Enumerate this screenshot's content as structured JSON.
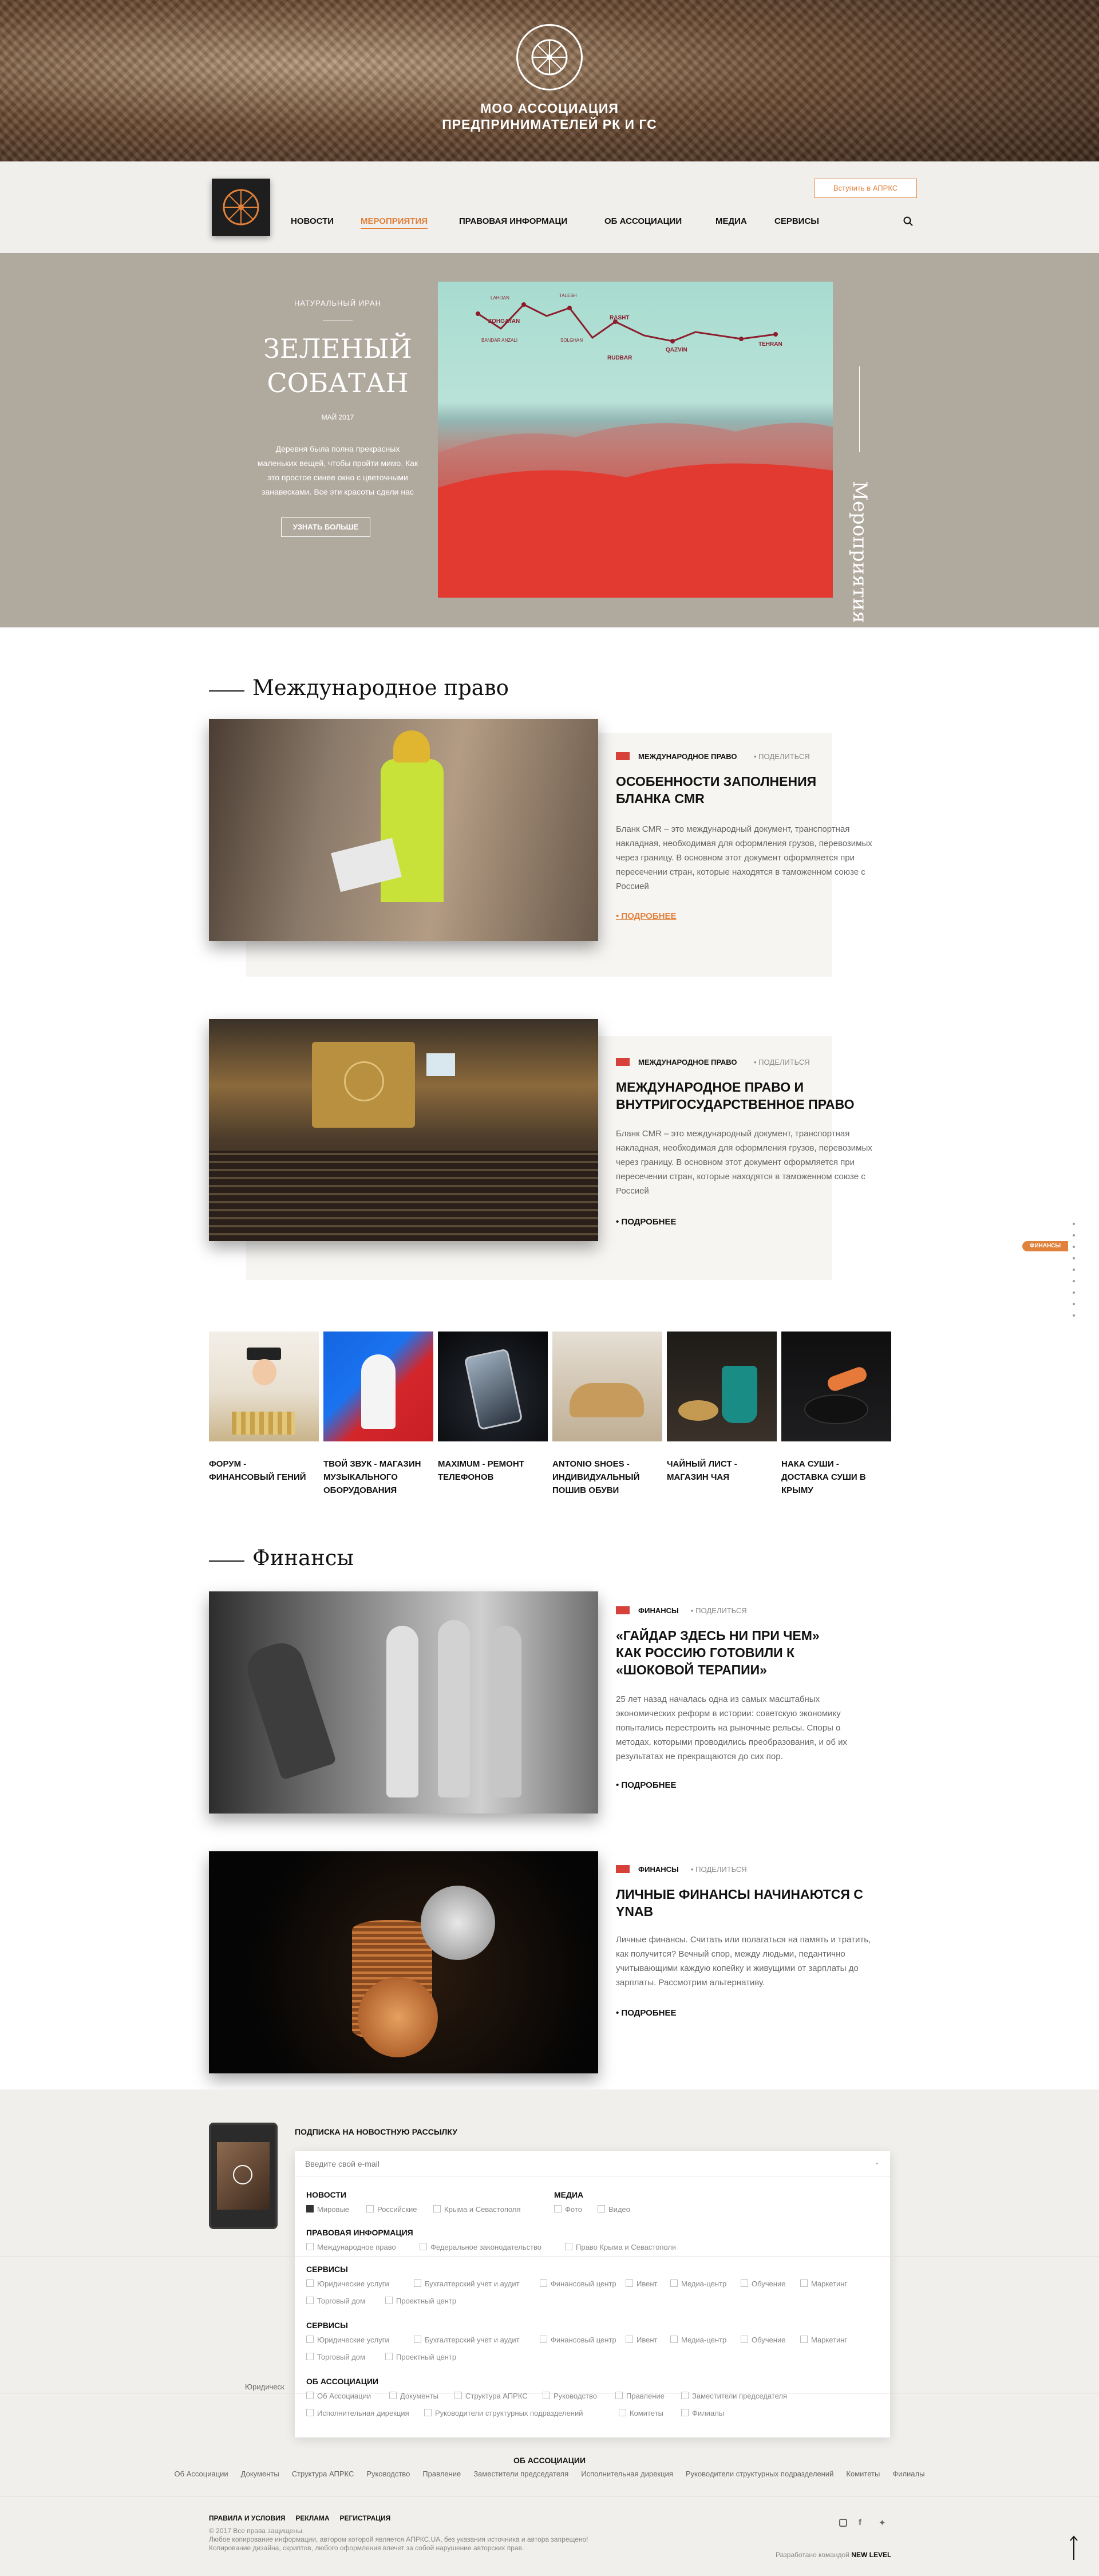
{
  "colors": {
    "accent": "#e0813c",
    "feature_bg": "#b0a99e",
    "header_bg": "#f1efec",
    "flag": "#d8403a"
  },
  "hero": {
    "title_line1": "МОО АССОЦИАЦИЯ",
    "title_line2": "ПРЕДПРИНИМАТЕЛЕЙ РК И ГС",
    "logo_icon": "wheel-emblem-icon"
  },
  "header": {
    "join_button": "Вступить в АПРКС",
    "nav": [
      "НОВОСТИ",
      "МЕРОПРИЯТИЯ",
      "ПРАВОВАЯ ИНФОРМАЦИ",
      "ОБ АССОЦИАЦИИ",
      "МЕДИА",
      "СЕРВИСЫ"
    ],
    "active_nav": "МЕРОПРИЯТИЯ",
    "search_icon": "search-icon"
  },
  "feature": {
    "category": "НАТУРАЛЬНЫЙ ИРАН",
    "title_line1": "ЗЕЛЕНЫЙ",
    "title_line2": "СОБАТАН",
    "date": "МАЙ 2017",
    "text_lines": [
      "Деревня была полна прекрасных",
      "маленьких вещей, чтобы пройти мимо. Как",
      "это простое синее окно с цветочными",
      "занавесками. Все эти красоты сдели нас"
    ],
    "button": "УЗНАТЬ БОЛЬШЕ",
    "vertical_label": "Мероприятия",
    "map_labels": [
      "ZOHGATAN",
      "LAHIJAN",
      "TALESH",
      "RASHT",
      "SOLGHAN",
      "QAZVIN",
      "TEHRAN",
      "RUDBAR",
      "BANDAR ANZALI"
    ]
  },
  "sections": {
    "law": {
      "title": "Международное право",
      "articles": [
        {
          "category": "МЕЖДУНАРОДНОЕ ПРАВО",
          "share": "ПОДЕЛИТЬСЯ",
          "title_lines": [
            "ОСОБЕННОСТИ ЗАПОЛНЕНИЯ",
            "БЛАНКА CMR"
          ],
          "text_lines": [
            "Бланк CMR – это международный документ, транспортная",
            "накладная, необходимая для оформления грузов, перевозимых",
            "через границу. В основном этот документ оформляется при",
            "пересечении стран, которые находятся в таможенном союзе с",
            "Россией"
          ],
          "more": "ПОДРОБНЕЕ"
        },
        {
          "category": "МЕЖДУНАРОДНОЕ ПРАВО",
          "share": "ПОДЕЛИТЬСЯ",
          "title_lines": [
            "МЕЖДУНАРОДНОЕ ПРАВО И",
            "ВНУТРИГОСУДАРСТВЕННОЕ ПРАВО"
          ],
          "text_lines": [
            "Бланк CMR – это международный документ, транспортная",
            "накладная, необходимая для оформления грузов, перевозимых",
            "через границу. В основном этот документ оформляется при",
            "пересечении стран, которые находятся в таможенном союзе с",
            "Россией"
          ],
          "more": "ПОДРОБНЕЕ"
        }
      ]
    },
    "services": [
      {
        "lines": [
          "ФОРУМ -",
          "ФИНАНСОВЫЙ ГЕНИЙ"
        ]
      },
      {
        "lines": [
          "ТВОЙ ЗВУК - МАГАЗИН",
          "МУЗЫКАЛЬНОГО",
          "ОБОРУДОВАНИЯ"
        ]
      },
      {
        "lines": [
          "MAXIMUM - РЕМОНТ",
          "ТЕЛЕФОНОВ"
        ]
      },
      {
        "lines": [
          "ANTONIO SHOES -",
          "ИНДИВИДУАЛЬНЫЙ",
          "ПОШИВ ОБУВИ"
        ]
      },
      {
        "lines": [
          "ЧАЙНЫЙ ЛИСТ -",
          "МАГАЗИН ЧАЯ"
        ]
      },
      {
        "lines": [
          "НАКА СУШИ -",
          "ДОСТАВКА СУШИ В",
          "КРЫМУ"
        ]
      }
    ],
    "finance": {
      "title": "Финансы",
      "articles": [
        {
          "category": "ФИНАНСЫ",
          "share": "ПОДЕЛИТЬСЯ",
          "title_lines": [
            "«ГАЙДАР ЗДЕСЬ НИ ПРИ ЧЕМ»",
            "КАК РОССИЮ ГОТОВИЛИ К",
            "«ШОКОВОЙ ТЕРАПИИ»"
          ],
          "text_lines": [
            "25 лет назад началась одна из самых масштабных",
            "экономических реформ в истории: советскую экономику",
            "попытались перестроить на рыночные рельсы. Споры о",
            "методах, которыми проводились преобразования, и об их",
            "результатах не прекращаются до сих пор."
          ],
          "more": "ПОДРОБНЕЕ"
        },
        {
          "category": "ФИНАНСЫ",
          "share": "ПОДЕЛИТЬСЯ",
          "title_lines": [
            "ЛИЧНЫЕ ФИНАНСЫ НАЧИНАЮТСЯ С",
            "YNAB"
          ],
          "text_lines": [
            "Личные финансы. Считать или полагаться на память и тратить,",
            "как получится? Вечный спор, между людьми, педантично",
            "учитывающими каждую копейку и живущими от зарплаты до",
            "зарплаты. Рассмотрим альтернативу."
          ],
          "more": "ПОДРОБНЕЕ"
        }
      ]
    }
  },
  "side_indicator": {
    "label": "ФИНАНСЫ"
  },
  "subscribe": {
    "heading": "ПОДПИСКА НА НОВОСТНУЮ РАССЫЛКУ",
    "email_placeholder": "Введите свой e-mail",
    "groups": {
      "news": {
        "title": "НОВОСТИ",
        "items": [
          "Мировые",
          "Российские",
          "Крыма и Севастополя"
        ],
        "checked": [
          "Мировые"
        ]
      },
      "media": {
        "title": "МЕДИА",
        "items": [
          "Фото",
          "Видео"
        ]
      },
      "legal": {
        "title": "ПРАВОВАЯ ИНФОРМАЦИЯ",
        "items": [
          "Международное право",
          "Федеральное законодательство",
          "Право Крыма и Севастополя"
        ]
      },
      "services1": {
        "title": "СЕРВИСЫ",
        "items": [
          "Юридические услуги",
          "Бухгалтерский учет и аудит",
          "Финансовый центр",
          "Ивент",
          "Медиа-центр",
          "Обучение",
          "Маркетинг",
          "Торговый дом",
          "Проектный центр"
        ]
      },
      "services2": {
        "title": "СЕРВИСЫ",
        "items": [
          "Юридические услуги",
          "Бухгалтерский учет и аудит",
          "Финансовый центр",
          "Ивент",
          "Медиа-центр",
          "Обучение",
          "Маркетинг",
          "Торговый дом",
          "Проектный центр"
        ]
      },
      "about": {
        "title": "ОБ АССОЦИАЦИИ",
        "items": [
          "Об Ассоциации",
          "Документы",
          "Структура АПРКС",
          "Руководство",
          "Правление",
          "Заместители председателя",
          "Исполнительная дирекция",
          "Руководители структурных подразделений",
          "Комитеты",
          "Филиалы"
        ]
      }
    }
  },
  "footer": {
    "partial_label": "Юридическ",
    "about_title": "ОБ АССОЦИАЦИИ",
    "about_links": [
      "Об Ассоциации",
      "Документы",
      "Структура АПРКС",
      "Руководство",
      "Правление",
      "Заместители председателя",
      "Исполнительная дирекция",
      "Руководители структурных подразделений",
      "Комитеты",
      "Филиалы"
    ],
    "bottom_links": [
      "ПРАВИЛА И УСЛОВИЯ",
      "РЕКЛАМА",
      "РЕГИСТРАЦИЯ"
    ],
    "copyright_lines": [
      "© 2017 Все права защищены.",
      "Любое копирование информации, автором которой является АПРКС.UA, без указания источника и автора запрещено!",
      "Копирование дизайна, скриптов, любого оформления влечет за собой нарушение авторских прав."
    ],
    "developer_prefix": "Разработано командой",
    "developer_name": "NEW LEVEL",
    "social_icons": [
      "instagram-icon",
      "facebook-icon",
      "twitter-icon"
    ],
    "scroll_up_icon": "arrow-up-icon"
  }
}
